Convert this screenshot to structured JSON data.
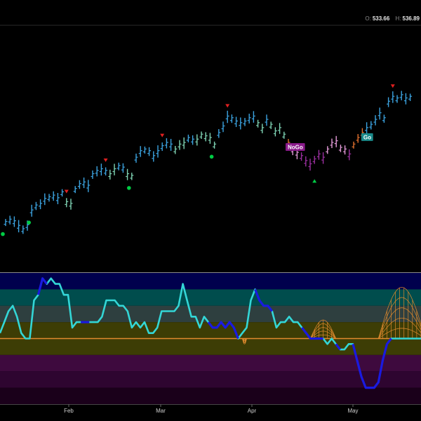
{
  "header": {
    "open_label": "O:",
    "open_value": "533.66",
    "high_label": "H:",
    "high_value": "536.89"
  },
  "colors": {
    "background": "#000000",
    "bar_strong_go": "#3ba3e0",
    "bar_weak_go": "#7fd3b4",
    "bar_weak_nogo": "#e39ad8",
    "bar_strong_nogo": "#9b2fa0",
    "bar_go_fish": "#e0702e",
    "go_trend_up_marker": "#00cc44",
    "countertrend_marker": "#e02020",
    "oscillator_line": "#33d6d6",
    "oscillator_heavy": "#1a1ae0",
    "oscillator_zero_line": "#e08a2e",
    "volume_cloud": "#e08a2e"
  },
  "chart_data": [
    {
      "type": "line",
      "kind": "price_bars",
      "x_tick_labels": [
        "Feb",
        "Mar",
        "Apr",
        "May"
      ],
      "signal_labels": [
        {
          "text": "NoGo",
          "x": 32.5,
          "color": "#8a1a8a"
        },
        {
          "text": "Go",
          "x": 41.2,
          "color": "#1a8a8a"
        }
      ],
      "ylim": [
        465,
        540
      ],
      "bars": [
        [
          0.0,
          480.0,
          1
        ],
        [
          0.5,
          480.7,
          1
        ],
        [
          1.0,
          480.2,
          1
        ],
        [
          1.5,
          478.8,
          1
        ],
        [
          2.0,
          477.8,
          1
        ],
        [
          2.5,
          479.0,
          1
        ],
        [
          3.0,
          483.5,
          1
        ],
        [
          3.5,
          485.0,
          1
        ],
        [
          4.0,
          485.5,
          1
        ],
        [
          4.5,
          487.0,
          1
        ],
        [
          5.0,
          487.5,
          1
        ],
        [
          5.5,
          488.0,
          1
        ],
        [
          6.0,
          487.2,
          1
        ],
        [
          6.5,
          489.0,
          1
        ],
        [
          7.0,
          486.0,
          2
        ],
        [
          7.5,
          485.5,
          2
        ],
        [
          8.0,
          490.0,
          1
        ],
        [
          8.5,
          491.5,
          1
        ],
        [
          9.0,
          492.0,
          1
        ],
        [
          9.5,
          491.0,
          1
        ],
        [
          10.0,
          494.5,
          1
        ],
        [
          10.5,
          495.5,
          1
        ],
        [
          11.0,
          496.0,
          1
        ],
        [
          11.5,
          495.5,
          1
        ],
        [
          12.0,
          494.5,
          2
        ],
        [
          12.5,
          496.0,
          2
        ],
        [
          13.0,
          497.0,
          1
        ],
        [
          13.5,
          496.5,
          1
        ],
        [
          14.0,
          494.5,
          2
        ],
        [
          14.5,
          494.0,
          2
        ],
        [
          15.0,
          499.5,
          1
        ],
        [
          15.5,
          501.5,
          1
        ],
        [
          16.0,
          502.0,
          1
        ],
        [
          16.5,
          501.5,
          1
        ],
        [
          17.0,
          500.0,
          1
        ],
        [
          17.5,
          501.5,
          1
        ],
        [
          18.0,
          503.0,
          1
        ],
        [
          18.5,
          504.0,
          1
        ],
        [
          19.0,
          503.5,
          1
        ],
        [
          19.5,
          502.0,
          2
        ],
        [
          20.0,
          503.5,
          2
        ],
        [
          20.5,
          504.0,
          2
        ],
        [
          21.0,
          505.5,
          1
        ],
        [
          21.5,
          505.0,
          1
        ],
        [
          22.0,
          505.0,
          2
        ],
        [
          22.5,
          506.5,
          2
        ],
        [
          23.0,
          506.0,
          2
        ],
        [
          23.5,
          505.5,
          2
        ],
        [
          24.0,
          503.5,
          2
        ],
        [
          24.5,
          507.0,
          1
        ],
        [
          25.0,
          509.0,
          1
        ],
        [
          25.5,
          512.0,
          1
        ],
        [
          26.0,
          511.5,
          1
        ],
        [
          26.5,
          510.5,
          1
        ],
        [
          27.0,
          510.0,
          1
        ],
        [
          27.5,
          510.5,
          1
        ],
        [
          28.0,
          511.5,
          1
        ],
        [
          28.5,
          512.0,
          1
        ],
        [
          29.0,
          510.0,
          2
        ],
        [
          29.5,
          508.5,
          2
        ],
        [
          30.0,
          511.0,
          1
        ],
        [
          30.5,
          509.5,
          2
        ],
        [
          31.0,
          507.5,
          2
        ],
        [
          31.5,
          508.5,
          2
        ],
        [
          32.0,
          506.5,
          2
        ],
        [
          32.5,
          504.0,
          5
        ],
        [
          33.0,
          502.0,
          3
        ],
        [
          33.5,
          501.0,
          3
        ],
        [
          34.0,
          500.0,
          4
        ],
        [
          34.5,
          498.5,
          4
        ],
        [
          35.0,
          497.5,
          4
        ],
        [
          35.5,
          499.0,
          4
        ],
        [
          36.0,
          500.5,
          4
        ],
        [
          36.5,
          499.5,
          4
        ],
        [
          37.0,
          502.0,
          3
        ],
        [
          37.5,
          504.0,
          3
        ],
        [
          38.0,
          504.5,
          3
        ],
        [
          38.5,
          502.5,
          3
        ],
        [
          39.0,
          502.0,
          3
        ],
        [
          39.5,
          500.5,
          4
        ],
        [
          40.0,
          503.5,
          5
        ],
        [
          40.5,
          505.5,
          5
        ],
        [
          41.0,
          507.0,
          5
        ],
        [
          41.5,
          508.5,
          1
        ],
        [
          42.0,
          509.5,
          1
        ],
        [
          42.5,
          511.0,
          1
        ],
        [
          43.0,
          513.0,
          1
        ],
        [
          43.5,
          511.5,
          1
        ],
        [
          44.0,
          516.5,
          1
        ],
        [
          44.5,
          518.0,
          1
        ],
        [
          45.0,
          517.5,
          1
        ],
        [
          45.5,
          518.5,
          1
        ],
        [
          46.0,
          517.5,
          1
        ],
        [
          46.5,
          518.0,
          1
        ]
      ],
      "go_trend_up_markers": [
        0.0,
        3.0,
        14.5,
        24.0
      ],
      "go_countertrend_down_markers": [
        7.0,
        11.5,
        18.0,
        25.5,
        44.5
      ],
      "nogo_countertrend_up_markers": [
        35.5
      ]
    },
    {
      "type": "area",
      "kind": "oscillator_panel",
      "ylim": [
        -6,
        6
      ],
      "values": [
        0.5,
        1.5,
        2.5,
        3.0,
        2.0,
        0.5,
        0.0,
        0.0,
        3.5,
        4.0,
        5.5,
        5.0,
        5.5,
        5.0,
        5.0,
        4.0,
        4.0,
        1.0,
        1.5,
        1.5,
        1.5,
        1.5,
        1.5,
        1.5,
        2.0,
        3.5,
        3.5,
        3.5,
        3.0,
        3.0,
        2.5,
        1.0,
        1.5,
        1.0,
        1.5,
        0.5,
        0.5,
        1.0,
        2.5,
        2.5,
        2.5,
        2.5,
        3.0,
        5.0,
        3.5,
        2.0,
        2.0,
        1.0,
        2.0,
        1.5,
        1.0,
        1.0,
        1.5,
        1.0,
        1.5,
        1.0,
        0.0,
        0.5,
        1.0,
        3.5,
        4.5,
        3.5,
        3.0,
        3.0,
        2.5,
        1.0,
        1.5,
        1.5,
        2.0,
        1.5,
        1.5,
        1.0,
        0.5,
        0.0,
        0.0,
        0.0,
        0.0,
        -0.5,
        0.0,
        -0.5,
        -1.0,
        -1.0,
        -0.5,
        -0.5,
        -2.0,
        -3.5,
        -4.5,
        -4.5,
        -4.5,
        -4.0,
        -2.0,
        -0.5,
        0.0,
        0.0,
        0.0,
        0.0,
        0.0,
        0.0,
        0.0,
        0.0,
        0.0,
        0.0,
        0.0,
        0.0,
        0.0,
        0.0,
        0.0,
        0.5,
        1.0,
        1.0,
        1.5,
        2.0,
        2.5,
        2.5,
        2.5,
        3.5,
        5.0,
        3.5,
        3.5,
        3.5,
        4.5,
        3.5
      ],
      "heavy_segments": [
        [
          9,
          11
        ],
        [
          19,
          21
        ],
        [
          49,
          56
        ],
        [
          60,
          64
        ],
        [
          71,
          76
        ],
        [
          79,
          80
        ],
        [
          83,
          92
        ]
      ],
      "volume_clouds": [
        {
          "from": 57,
          "to": 58,
          "peak": -0.5
        },
        {
          "from": 73,
          "to": 79,
          "peak": 1.7
        },
        {
          "from": 89,
          "to": 100,
          "peak": 4.7
        }
      ],
      "zone_colors": [
        {
          "from": 4.5,
          "to": 6,
          "color": "#00004d"
        },
        {
          "from": 3.0,
          "to": 4.5,
          "color": "#004d4d"
        },
        {
          "from": 1.5,
          "to": 3.0,
          "color": "#2e3f3f"
        },
        {
          "from": 0,
          "to": 1.5,
          "color": "#3d3d05"
        },
        {
          "from": -1.5,
          "to": 0,
          "color": "#3d3d05"
        },
        {
          "from": -3.0,
          "to": -1.5,
          "color": "#3e0a3e"
        },
        {
          "from": -4.5,
          "to": -3.0,
          "color": "#2e0530"
        },
        {
          "from": -6,
          "to": -4.5,
          "color": "#1a001a"
        }
      ]
    }
  ]
}
